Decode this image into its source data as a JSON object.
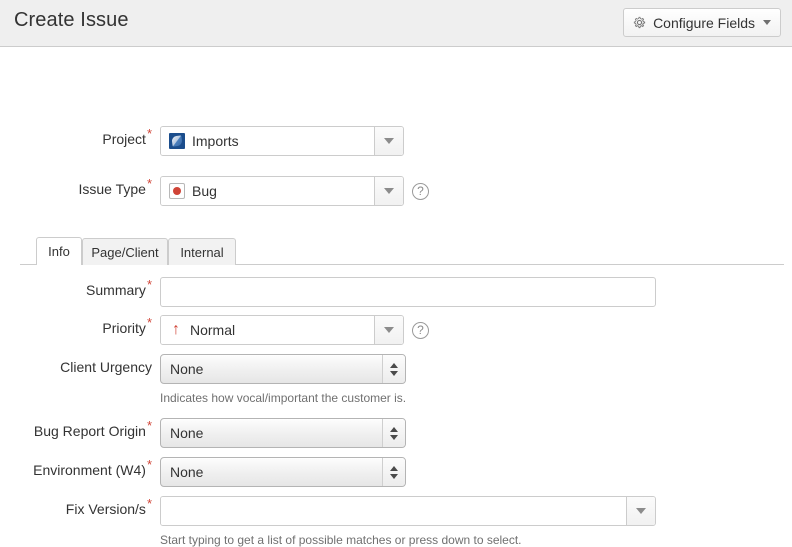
{
  "header": {
    "title": "Create Issue",
    "configure_fields_label": "Configure Fields",
    "gear_icon": "gear-icon",
    "caret_icon": "chevron-down-icon"
  },
  "form": {
    "fields": [
      {
        "label": "Project",
        "required": true,
        "type": "combo",
        "value": "Imports",
        "icon": "project-avatar-icon",
        "help": false
      },
      {
        "label": "Issue Type",
        "required": true,
        "type": "combo",
        "value": "Bug",
        "icon": "bug-icon",
        "help": true,
        "help_label": "?"
      },
      {
        "label": "Summary",
        "required": true,
        "type": "text",
        "value": "",
        "placeholder": "",
        "help": false
      },
      {
        "label": "Priority",
        "required": true,
        "type": "combo",
        "value": "Normal",
        "icon": "priority-up-arrow-icon",
        "help": true,
        "help_label": "?"
      },
      {
        "label": "Client Urgency",
        "required": false,
        "type": "select",
        "value": "None",
        "description": "Indicates how vocal/important the customer is.",
        "help": false
      },
      {
        "label": "Bug Report Origin",
        "required": true,
        "type": "select",
        "value": "None",
        "help": false
      },
      {
        "label": "Environment (W4)",
        "required": true,
        "type": "select",
        "value": "None",
        "help": false
      },
      {
        "label": "Fix Version/s",
        "required": true,
        "type": "combo-empty",
        "value": "",
        "description": "Start typing to get a list of possible matches or press down to select.",
        "help": false
      }
    ],
    "required_marker": "*"
  },
  "tabs": [
    {
      "label": "Info",
      "active": true
    },
    {
      "label": "Page/Client",
      "active": false
    },
    {
      "label": "Internal",
      "active": false
    }
  ],
  "colors": {
    "header_bg": "#efefef",
    "required_star": "#d04437",
    "border": "#cccccc",
    "text": "#333333",
    "muted_text": "#707070",
    "project_icon_bg": "#1b4d8c"
  }
}
